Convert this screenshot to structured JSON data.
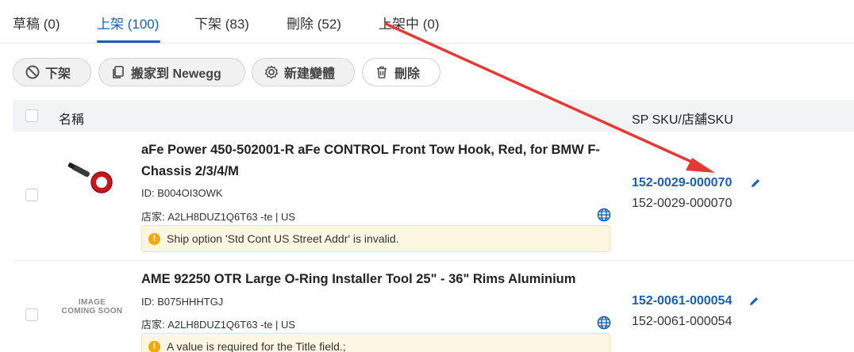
{
  "tabs": [
    {
      "label": "草稿 (0)"
    },
    {
      "label": "上架 (100)",
      "active": true
    },
    {
      "label": "下架 (83)"
    },
    {
      "label": "刪除 (52)"
    },
    {
      "label": "上架中 (0)"
    }
  ],
  "toolbar": {
    "unlist_label": "下架",
    "move_label": "搬家到 Newegg",
    "new_variant_label": "新建變體",
    "delete_label": "刪除"
  },
  "table": {
    "col_name": "名稱",
    "col_sku": "SP SKU/店舖SKU"
  },
  "rows": [
    {
      "title": "aFe Power 450-502001-R aFe CONTROL Front Tow Hook, Red, for BMW F-Chassis 2/3/4/M",
      "id": "ID: B004OI3OWK",
      "store": "店家: A2LH8DUZ1Q6T63 -te | US",
      "warning": "Ship option 'Std Cont US Street Addr' is invalid.",
      "sp_sku": "152-0029-000070",
      "store_sku": "152-0029-000070"
    },
    {
      "image_placeholder": "IMAGE COMING SOON",
      "title": "AME 92250 OTR Large O-Ring Installer Tool 25\" - 36\" Rims Aluminium",
      "id": "ID: B075HHHTGJ",
      "store": "店家: A2LH8DUZ1Q6T63 -te | US",
      "warning": "A value is required for the Title field.;",
      "sp_sku": "152-0061-000054",
      "store_sku": "152-0061-000054"
    }
  ],
  "icons": {
    "unlist": "ban-icon",
    "move": "copy-icon",
    "new_variant": "gear-icon",
    "delete": "trash-icon",
    "marketplace": "globe-icon",
    "edit": "pencil-icon",
    "warning": "warning-icon"
  },
  "colors": {
    "accent": "#1a5fb4",
    "warning_bg": "#fdf6e3",
    "warning_icon": "#f2a900",
    "annotation_arrow": "#e53935"
  }
}
